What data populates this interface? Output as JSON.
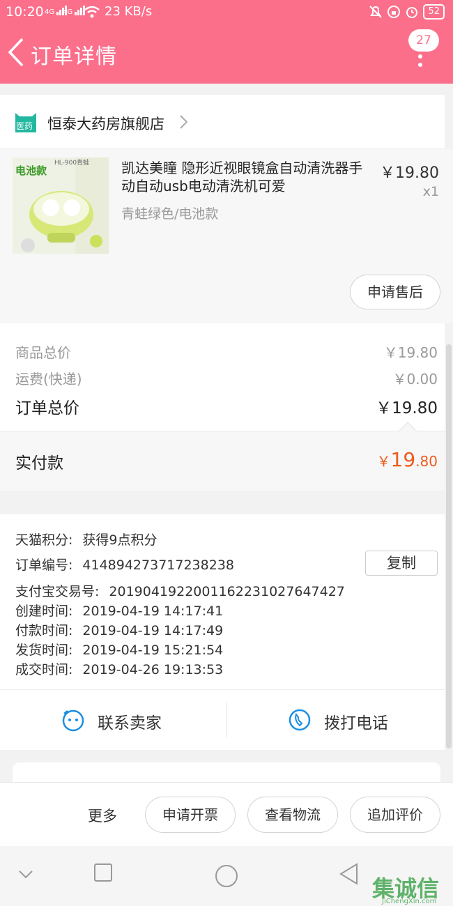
{
  "status_bar": {
    "time": "10:20",
    "signal1": "4G",
    "signal2": "4G",
    "speed": "23 KB/s",
    "battery": "52"
  },
  "header": {
    "title": "订单详情",
    "badge": "27"
  },
  "shop": {
    "logo_text": "医药",
    "name": "恒泰大药房旗舰店"
  },
  "product": {
    "image_label": "电池款",
    "image_model": "HL-900青蛙",
    "title": "凯达美瞳 隐形近视眼镜盒自动清洗器手动自动usb电动清洗机可爱",
    "spec": "青蛙绿色/电池款",
    "price": "￥19.80",
    "qty": "x1",
    "after_sale_label": "申请售后"
  },
  "price": {
    "goods_total_label": "商品总价",
    "goods_total": "￥19.80",
    "shipping_label": "运费(快递)",
    "shipping": "￥0.00",
    "order_total_label": "订单总价",
    "order_total": "￥19.80",
    "paid_label": "实付款",
    "paid_symbol": "￥",
    "paid_int": "19",
    "paid_dec": ".80"
  },
  "info": {
    "points_label": "天猫积分:",
    "points_value": "获得9点积分",
    "order_no_label": "订单编号:",
    "order_no": "414894273717238238",
    "copy_label": "复制",
    "alipay_label": "支付宝交易号:",
    "alipay_no": "2019041922001162231027647427",
    "created_label": "创建时间:",
    "created": "2019-04-19 14:17:41",
    "paid_time_label": "付款时间:",
    "paid_time": "2019-04-19 14:17:49",
    "shipped_label": "发货时间:",
    "shipped": "2019-04-19 15:21:54",
    "done_label": "成交时间:",
    "done": "2019-04-26 19:13:53"
  },
  "contact": {
    "seller_label": "联系卖家",
    "call_label": "拨打电话"
  },
  "bottom": {
    "more_label": "更多",
    "invoice_label": "申请开票",
    "logistics_label": "查看物流",
    "review_label": "追加评价"
  },
  "watermark": {
    "text": "集诚信",
    "url": "JiChengXin.com"
  },
  "colors": {
    "brand": "#fb6f8b",
    "price_accent": "#f05a1a"
  }
}
